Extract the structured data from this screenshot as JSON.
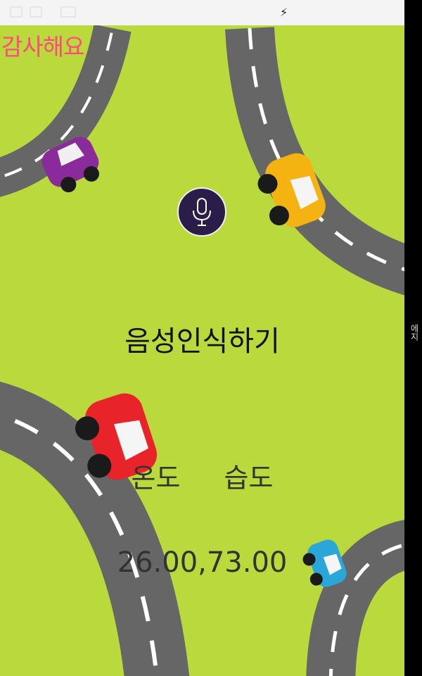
{
  "header": {
    "thanks_text": "감사해요"
  },
  "main": {
    "voice_label": "음성인식하기",
    "temp_label": "온도",
    "humidity_label": "습도",
    "readings_text": "26.00,73.00"
  },
  "side": {
    "label": "에지"
  },
  "icons": {
    "mic": "microphone-icon",
    "charging": "lightning-icon"
  },
  "colors": {
    "background": "#b9d93c",
    "accent_pink": "#ff4a7a",
    "mic_bg": "#2b1d4a"
  }
}
